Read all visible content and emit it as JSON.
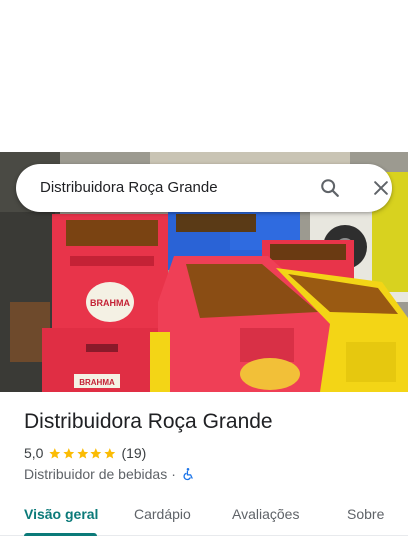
{
  "search": {
    "query": "Distribuidora Roça Grande",
    "search_icon": "search-icon",
    "close_icon": "close-icon"
  },
  "photo": {
    "subject": "crates",
    "crate_text": [
      "BRAHMA",
      "BRAHMA"
    ]
  },
  "place": {
    "name": "Distribuidora Roça Grande",
    "rating": "5,0",
    "stars": 5,
    "review_count": "(19)",
    "category": "Distribuidor de bebidas",
    "separator": "·",
    "accessibility_icon": "wheelchair-icon"
  },
  "tabs": [
    {
      "label": "Visão geral",
      "active": true
    },
    {
      "label": "Cardápio",
      "active": false
    },
    {
      "label": "Avaliações",
      "active": false
    },
    {
      "label": "Sobre",
      "active": false
    }
  ],
  "colors": {
    "accent": "#0b7a79",
    "star": "#fbbc04",
    "crate_red": "#e8344a",
    "crate_yellow": "#f3d516",
    "crate_blue": "#2a63d6"
  }
}
